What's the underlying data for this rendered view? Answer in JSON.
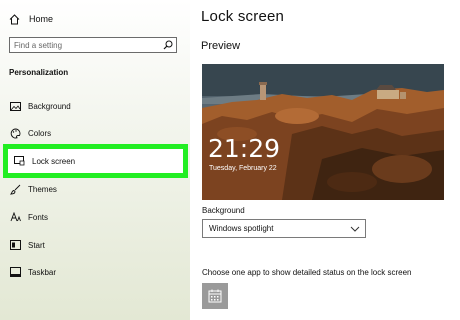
{
  "sidebar": {
    "home_label": "Home",
    "search_placeholder": "Find a setting",
    "section_label": "Personalization",
    "items": [
      {
        "label": "Background",
        "icon": "image-icon"
      },
      {
        "label": "Colors",
        "icon": "palette-icon"
      },
      {
        "label": "Lock screen",
        "icon": "lock-screen-icon",
        "selected": true
      },
      {
        "label": "Themes",
        "icon": "brush-icon"
      },
      {
        "label": "Fonts",
        "icon": "font-icon"
      },
      {
        "label": "Start",
        "icon": "start-icon"
      },
      {
        "label": "Taskbar",
        "icon": "taskbar-icon"
      }
    ]
  },
  "main": {
    "title": "Lock screen",
    "preview_label": "Preview",
    "preview_time": "21:29",
    "preview_date": "Tuesday, February 22",
    "background_label": "Background",
    "background_value": "Windows spotlight",
    "app_status_label": "Choose one app to show detailed status on the lock screen",
    "app_tile_icon": "calendar-icon"
  },
  "colors": {
    "highlight": "#22ee22",
    "tile": "#9a9a9a"
  }
}
